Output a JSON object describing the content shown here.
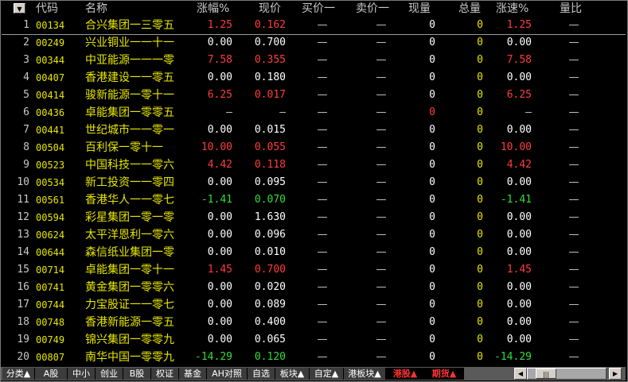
{
  "header": {
    "sort_icon": "▼",
    "columns": [
      "代码",
      "名称",
      "涨幅%",
      "现价",
      "买价一",
      "卖价一",
      "现量",
      "总量",
      "涨速%",
      "量比"
    ]
  },
  "colors": {
    "up": "#ff3c3c",
    "down": "#33dd33",
    "neutral": "#ffffff",
    "dash": "#c8c8c8",
    "vol_zero": "#e6e600"
  },
  "rows": [
    {
      "idx": "1",
      "code": "00134",
      "name": "合兴集团一三零五",
      "chg": "1.25",
      "price": "0.162",
      "bid": "—",
      "ask": "—",
      "vol": "0",
      "total": "0",
      "speed": "1.25",
      "ratio": "—",
      "dir": "up"
    },
    {
      "idx": "2",
      "code": "00249",
      "name": "兴业铜业一一十一",
      "chg": "0.00",
      "price": "0.700",
      "bid": "—",
      "ask": "—",
      "vol": "0",
      "total": "0",
      "speed": "0.00",
      "ratio": "—",
      "dir": "flat"
    },
    {
      "idx": "3",
      "code": "00344",
      "name": "中亚能源一一一零",
      "chg": "7.58",
      "price": "0.355",
      "bid": "—",
      "ask": "—",
      "vol": "0",
      "total": "0",
      "speed": "7.58",
      "ratio": "—",
      "dir": "up"
    },
    {
      "idx": "4",
      "code": "00407",
      "name": "香港建设一一零五",
      "chg": "0.00",
      "price": "0.180",
      "bid": "—",
      "ask": "—",
      "vol": "0",
      "total": "0",
      "speed": "0.00",
      "ratio": "—",
      "dir": "flat"
    },
    {
      "idx": "5",
      "code": "00414",
      "name": "骏新能源一零十一",
      "chg": "6.25",
      "price": "0.017",
      "bid": "—",
      "ask": "—",
      "vol": "0",
      "total": "0",
      "speed": "6.25",
      "ratio": "—",
      "dir": "up"
    },
    {
      "idx": "6",
      "code": "00436",
      "name": "卓能集团一零零五",
      "chg": "—",
      "price": "—",
      "bid": "—",
      "ask": "—",
      "vol": "0",
      "total": "0",
      "speed": "—",
      "ratio": "—",
      "dir": "none",
      "vol_red": true
    },
    {
      "idx": "7",
      "code": "00441",
      "name": "世纪城市一一零一",
      "chg": "0.00",
      "price": "0.015",
      "bid": "—",
      "ask": "—",
      "vol": "0",
      "total": "0",
      "speed": "0.00",
      "ratio": "—",
      "dir": "flat"
    },
    {
      "idx": "8",
      "code": "00504",
      "name": "百利保一零十一",
      "chg": "10.00",
      "price": "0.055",
      "bid": "—",
      "ask": "—",
      "vol": "0",
      "total": "0",
      "speed": "10.00",
      "ratio": "—",
      "dir": "up"
    },
    {
      "idx": "9",
      "code": "00523",
      "name": "中国科技一一零六",
      "chg": "4.42",
      "price": "0.118",
      "bid": "—",
      "ask": "—",
      "vol": "0",
      "total": "0",
      "speed": "4.42",
      "ratio": "—",
      "dir": "up"
    },
    {
      "idx": "10",
      "code": "00534",
      "name": "新工投资一一零四",
      "chg": "0.00",
      "price": "0.095",
      "bid": "—",
      "ask": "—",
      "vol": "0",
      "total": "0",
      "speed": "0.00",
      "ratio": "—",
      "dir": "flat"
    },
    {
      "idx": "11",
      "code": "00561",
      "name": "香港华人一一零七",
      "chg": "-1.41",
      "price": "0.070",
      "bid": "—",
      "ask": "—",
      "vol": "0",
      "total": "0",
      "speed": "-1.41",
      "ratio": "—",
      "dir": "down"
    },
    {
      "idx": "12",
      "code": "00594",
      "name": "彩星集团一零一零",
      "chg": "0.00",
      "price": "1.630",
      "bid": "—",
      "ask": "—",
      "vol": "0",
      "total": "0",
      "speed": "0.00",
      "ratio": "—",
      "dir": "flat"
    },
    {
      "idx": "13",
      "code": "00624",
      "name": "太平洋恩利一零六",
      "chg": "0.00",
      "price": "0.096",
      "bid": "—",
      "ask": "—",
      "vol": "0",
      "total": "0",
      "speed": "0.00",
      "ratio": "—",
      "dir": "flat"
    },
    {
      "idx": "14",
      "code": "00644",
      "name": "森信纸业集团一零",
      "chg": "0.00",
      "price": "0.010",
      "bid": "—",
      "ask": "—",
      "vol": "0",
      "total": "0",
      "speed": "0.00",
      "ratio": "—",
      "dir": "flat"
    },
    {
      "idx": "15",
      "code": "00714",
      "name": "卓能集团一零十一",
      "chg": "1.45",
      "price": "0.700",
      "bid": "—",
      "ask": "—",
      "vol": "0",
      "total": "0",
      "speed": "1.45",
      "ratio": "—",
      "dir": "up"
    },
    {
      "idx": "16",
      "code": "00741",
      "name": "黄金集团一零零六",
      "chg": "0.00",
      "price": "0.020",
      "bid": "—",
      "ask": "—",
      "vol": "0",
      "total": "0",
      "speed": "0.00",
      "ratio": "—",
      "dir": "flat"
    },
    {
      "idx": "17",
      "code": "00744",
      "name": "力宝股证一一零七",
      "chg": "0.00",
      "price": "0.089",
      "bid": "—",
      "ask": "—",
      "vol": "0",
      "total": "0",
      "speed": "0.00",
      "ratio": "—",
      "dir": "flat"
    },
    {
      "idx": "18",
      "code": "00748",
      "name": "香港新能源一零五",
      "chg": "0.00",
      "price": "0.400",
      "bid": "—",
      "ask": "—",
      "vol": "0",
      "total": "0",
      "speed": "0.00",
      "ratio": "—",
      "dir": "flat"
    },
    {
      "idx": "19",
      "code": "00749",
      "name": "锦兴集团一零零九",
      "chg": "0.00",
      "price": "0.065",
      "bid": "—",
      "ask": "—",
      "vol": "0",
      "total": "0",
      "speed": "0.00",
      "ratio": "—",
      "dir": "flat"
    },
    {
      "idx": "20",
      "code": "00807",
      "name": "南华中国一零零九",
      "chg": "-14.29",
      "price": "0.120",
      "bid": "—",
      "ask": "—",
      "vol": "0",
      "total": "0",
      "speed": "-14.29",
      "ratio": "—",
      "dir": "down"
    }
  ],
  "tabs": [
    {
      "label": "分类▲",
      "active": false
    },
    {
      "label": "A股",
      "active": false
    },
    {
      "label": "中小",
      "active": false
    },
    {
      "label": "创业",
      "active": false
    },
    {
      "label": "B股",
      "active": false
    },
    {
      "label": "权证",
      "active": false
    },
    {
      "label": "基金",
      "active": false
    },
    {
      "label": "AH对照",
      "active": false
    },
    {
      "label": "自选",
      "active": false
    },
    {
      "label": "板块▲",
      "active": false
    },
    {
      "label": "自定▲",
      "active": false
    },
    {
      "label": "港板块▲",
      "active": false
    },
    {
      "label": "港股▲",
      "active": true
    },
    {
      "label": "期货▲",
      "active": true
    }
  ],
  "scroll": {
    "left_icon": "◀",
    "thumb_icon": "|||",
    "right_icon": "▶"
  }
}
